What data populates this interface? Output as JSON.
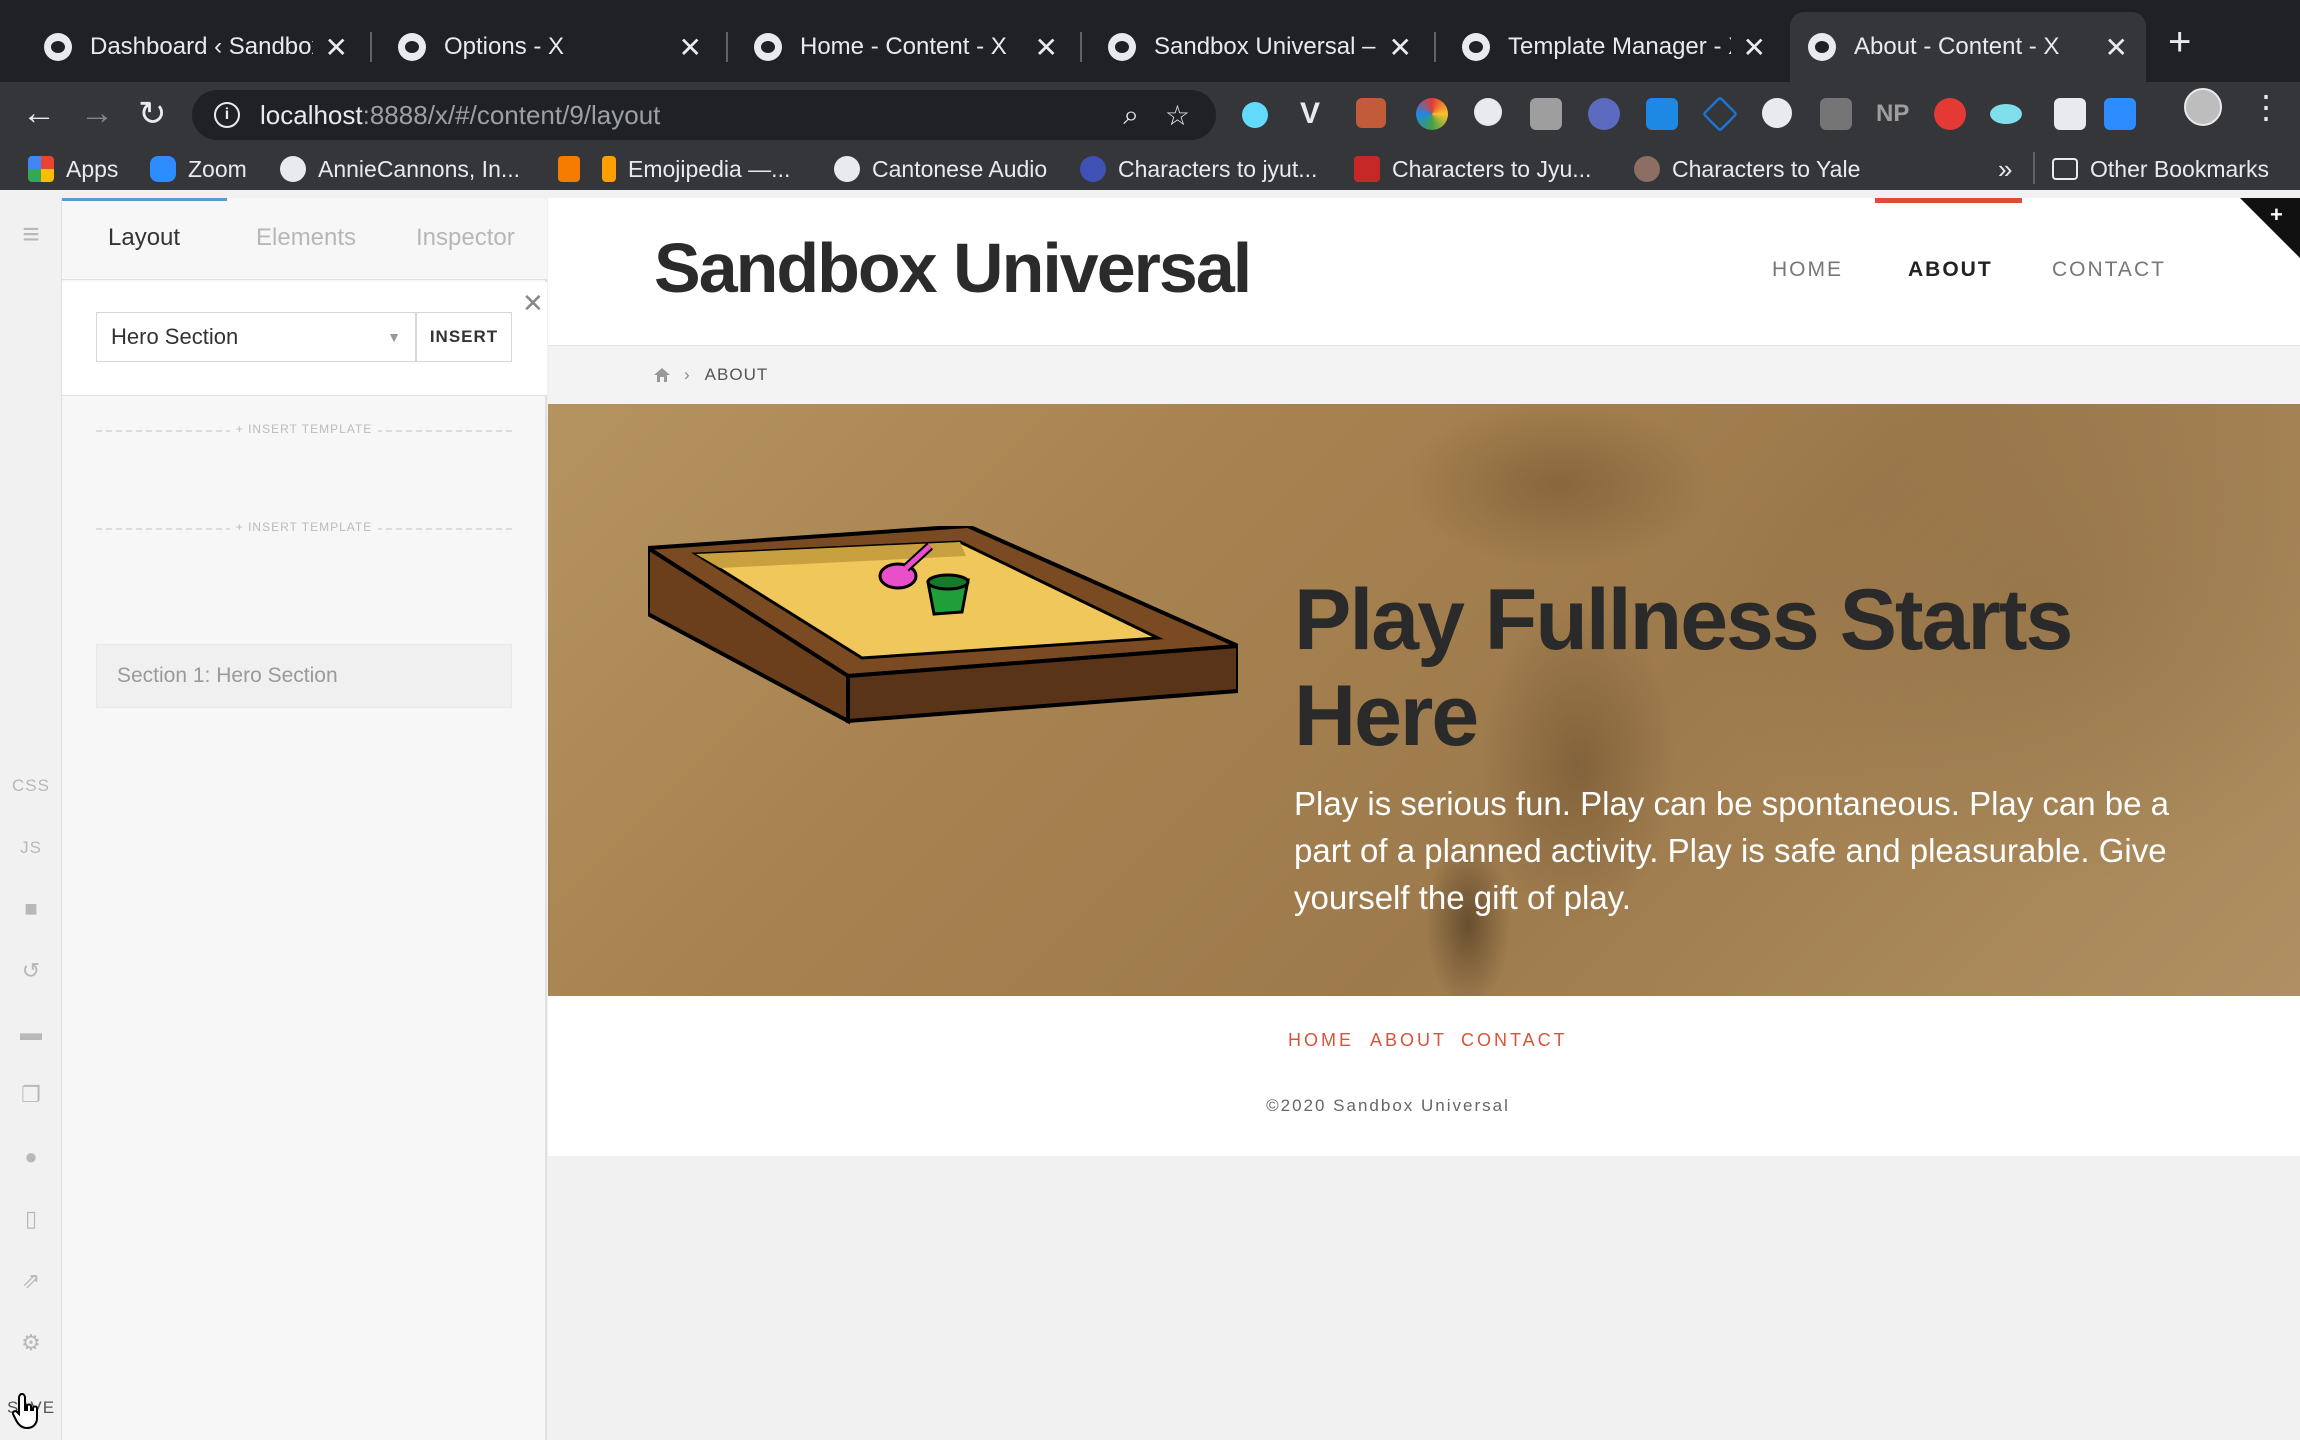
{
  "browser": {
    "tabs": [
      {
        "title": "Dashboard ‹ Sandbox U",
        "active": false
      },
      {
        "title": "Options - X",
        "active": false
      },
      {
        "title": "Home - Content - X",
        "active": false
      },
      {
        "title": "Sandbox Universal – W",
        "active": false
      },
      {
        "title": "Template Manager - X",
        "active": false
      },
      {
        "title": "About - Content - X",
        "active": true
      }
    ],
    "url_host": "localhost",
    "url_rest": ":8888/x/#/content/9/layout",
    "bookmarks": [
      {
        "label": "Apps",
        "icon": "apps-grid-icon"
      },
      {
        "label": "Zoom",
        "icon": "zoom-icon"
      },
      {
        "label": "AnnieCannons, In...",
        "icon": "github-icon"
      },
      {
        "label": "",
        "icon": "bookmark-orange-icon"
      },
      {
        "label": "Emojipedia —...",
        "icon": "bookmark-yellow-icon"
      },
      {
        "label": "Cantonese Audio",
        "icon": "globe-icon"
      },
      {
        "label": "Characters to jyut...",
        "icon": "bookmark-blue-icon"
      },
      {
        "label": "Characters to Jyu...",
        "icon": "bookmark-red-icon"
      },
      {
        "label": "Characters to Yale",
        "icon": "bookmark-figure-icon"
      }
    ],
    "bookmarks_overflow": "»",
    "other_bookmarks": "Other Bookmarks"
  },
  "rail": {
    "css_label": "CSS",
    "js_label": "JS",
    "save_label": "SAVE"
  },
  "panel": {
    "tabs": [
      "Layout",
      "Elements",
      "Inspector"
    ],
    "active_tab": "Layout",
    "select_value": "Hero Section",
    "insert_label": "INSERT",
    "insert_template_label": "+ INSERT TEMPLATE",
    "sections": [
      "Section 1: Hero Section"
    ]
  },
  "site": {
    "title": "Sandbox Universal",
    "nav": [
      "HOME",
      "ABOUT",
      "CONTACT"
    ],
    "active_nav": "ABOUT",
    "breadcrumb_current": "ABOUT",
    "hero_title": "Play Fullness Starts Here",
    "hero_text": "Play is serious fun. Play can be spontaneous. Play can be a part of a planned activity. Play is safe and pleasurable. Give yourself the gift of play.",
    "footer_nav": [
      "HOME",
      "ABOUT",
      "CONTACT"
    ],
    "copyright": "©2020 Sandbox Universal"
  },
  "colors": {
    "accent_red": "#e04b32",
    "footer_link": "#d9533a",
    "panel_tab_underline": "#5b9bd5"
  }
}
